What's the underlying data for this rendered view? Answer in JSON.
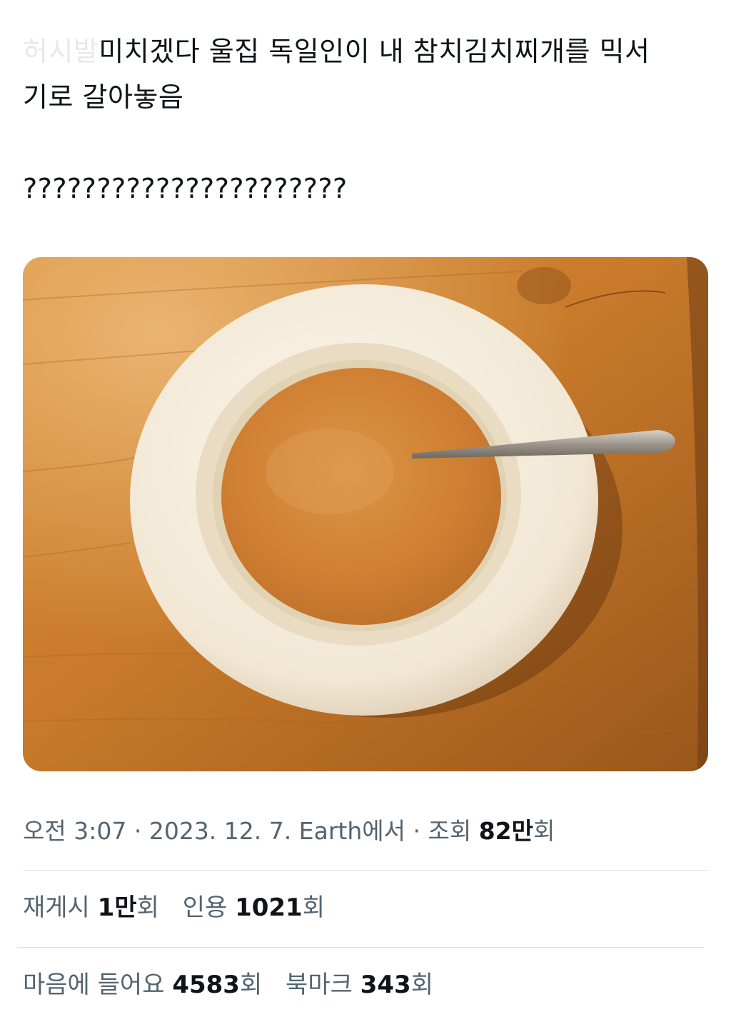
{
  "tweet": {
    "lines": [
      {
        "faded": "허시발",
        "text": "미치겠다  울집 독일인이 내 참치김치찌개를 믹서"
      },
      {
        "text": "기로 갈아놓음"
      },
      {
        "text": "??????????????????????"
      }
    ]
  },
  "meta": {
    "time": "오전 3:07",
    "date": "2023. 12. 7.",
    "location": "Earth에서",
    "views_label": "조회",
    "views_value": "82만",
    "views_unit": "회",
    "separator": "·"
  },
  "engagement": {
    "reposts": {
      "label": "재게시",
      "value": "1만",
      "unit": "회"
    },
    "quotes": {
      "label": "인용",
      "value": "1021",
      "unit": "회"
    },
    "likes": {
      "label": "마음에 들어요",
      "value": "4583",
      "unit": "회"
    },
    "bookmarks": {
      "label": "북마크",
      "value": "343",
      "unit": "회"
    }
  },
  "colors": {
    "text_primary": "#0f1419",
    "text_secondary": "#536471",
    "divider": "#dfe3e7",
    "table_wood": "#c9812f",
    "soup": "#d4842f",
    "plate": "#f3ecdf"
  }
}
